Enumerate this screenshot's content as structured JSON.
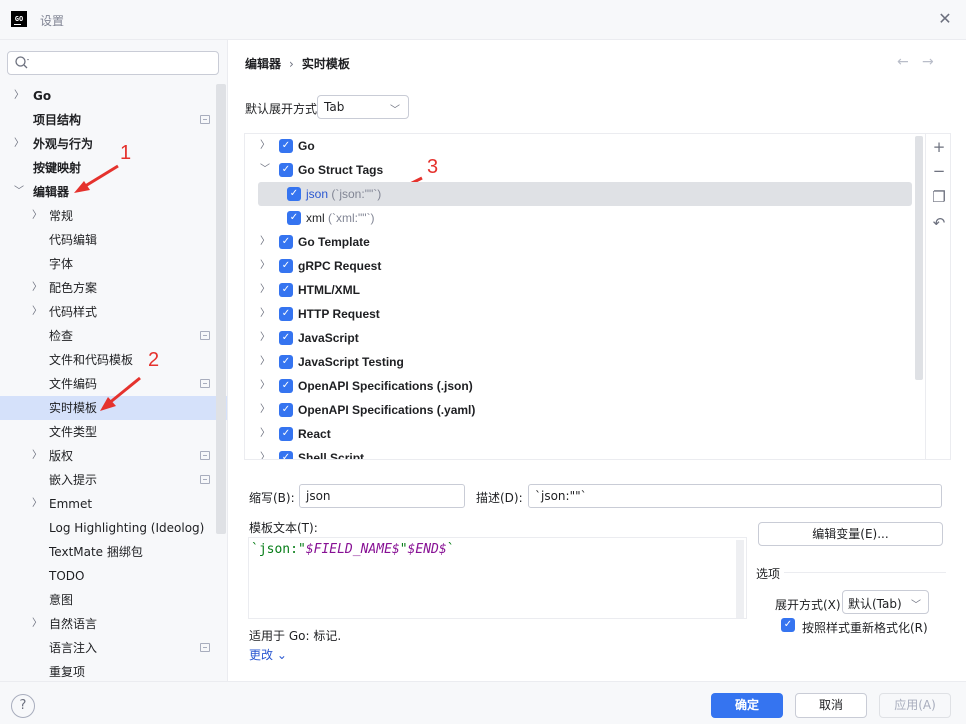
{
  "window": {
    "title": "设置",
    "app_icon_text": "GO"
  },
  "sidebar": {
    "search_placeholder": "",
    "items": [
      {
        "label": "Go",
        "bold": false
      },
      {
        "label": "项目结构",
        "bold": true
      },
      {
        "label": "外观与行为",
        "bold": true
      },
      {
        "label": "按键映射",
        "bold": true
      },
      {
        "label": "编辑器",
        "bold": true
      },
      {
        "label": "常规"
      },
      {
        "label": "代码编辑"
      },
      {
        "label": "字体"
      },
      {
        "label": "配色方案"
      },
      {
        "label": "代码样式"
      },
      {
        "label": "检查"
      },
      {
        "label": "文件和代码模板"
      },
      {
        "label": "文件编码"
      },
      {
        "label": "实时模板"
      },
      {
        "label": "文件类型"
      },
      {
        "label": "版权"
      },
      {
        "label": "嵌入提示"
      },
      {
        "label": "Emmet"
      },
      {
        "label": "Log Highlighting (Ideolog)"
      },
      {
        "label": "TextMate 捆绑包"
      },
      {
        "label": "TODO"
      },
      {
        "label": "意图"
      },
      {
        "label": "自然语言"
      },
      {
        "label": "语言注入"
      },
      {
        "label": "重复项"
      }
    ]
  },
  "annotations": {
    "n1": "1",
    "n2": "2",
    "n3": "3"
  },
  "breadcrumb": {
    "parent": "编辑器",
    "sep": "›",
    "current": "实时模板"
  },
  "nav": {
    "back": "←",
    "forward": "→"
  },
  "expand_default": {
    "label": "默认展开方式",
    "value": "Tab"
  },
  "tree": {
    "rows": [
      {
        "label": "Go"
      },
      {
        "label": "Go Struct Tags"
      },
      {
        "label": "json",
        "desc": " (`json:\"\"`)"
      },
      {
        "label": "xml",
        "desc": " (`xml:\"\"`)"
      },
      {
        "label": "Go Template"
      },
      {
        "label": "gRPC Request"
      },
      {
        "label": "HTML/XML"
      },
      {
        "label": "HTTP Request"
      },
      {
        "label": "JavaScript"
      },
      {
        "label": "JavaScript Testing"
      },
      {
        "label": "OpenAPI Specifications (.json)"
      },
      {
        "label": "OpenAPI Specifications (.yaml)"
      },
      {
        "label": "React"
      },
      {
        "label": "Shell Script"
      }
    ]
  },
  "editor": {
    "abbr_label": "缩写(B):",
    "abbr_value": "json",
    "desc_label": "描述(D):",
    "desc_value": "`json:\"\"`",
    "template_label": "模板文本(T):",
    "code_1": "`json:\"",
    "code_2": "$FIELD_NAME$",
    "code_3": "\"",
    "code_4": "$END$",
    "code_5": "`",
    "edit_vars": "编辑变量(E)...",
    "options_label": "选项",
    "expand_label": "展开方式(X)",
    "expand_value": "默认(Tab)",
    "reformat_label": "按照样式重新格式化(R)",
    "applies_to": "适用于 Go: 标记.",
    "change_link": "更改 ⌄"
  },
  "footer": {
    "help": "?",
    "ok": "确定",
    "cancel": "取消",
    "apply": "应用(A)"
  },
  "colors": {
    "accent": "#3574f0",
    "annotation": "#e5322d",
    "selection": "#d5e1fa"
  }
}
